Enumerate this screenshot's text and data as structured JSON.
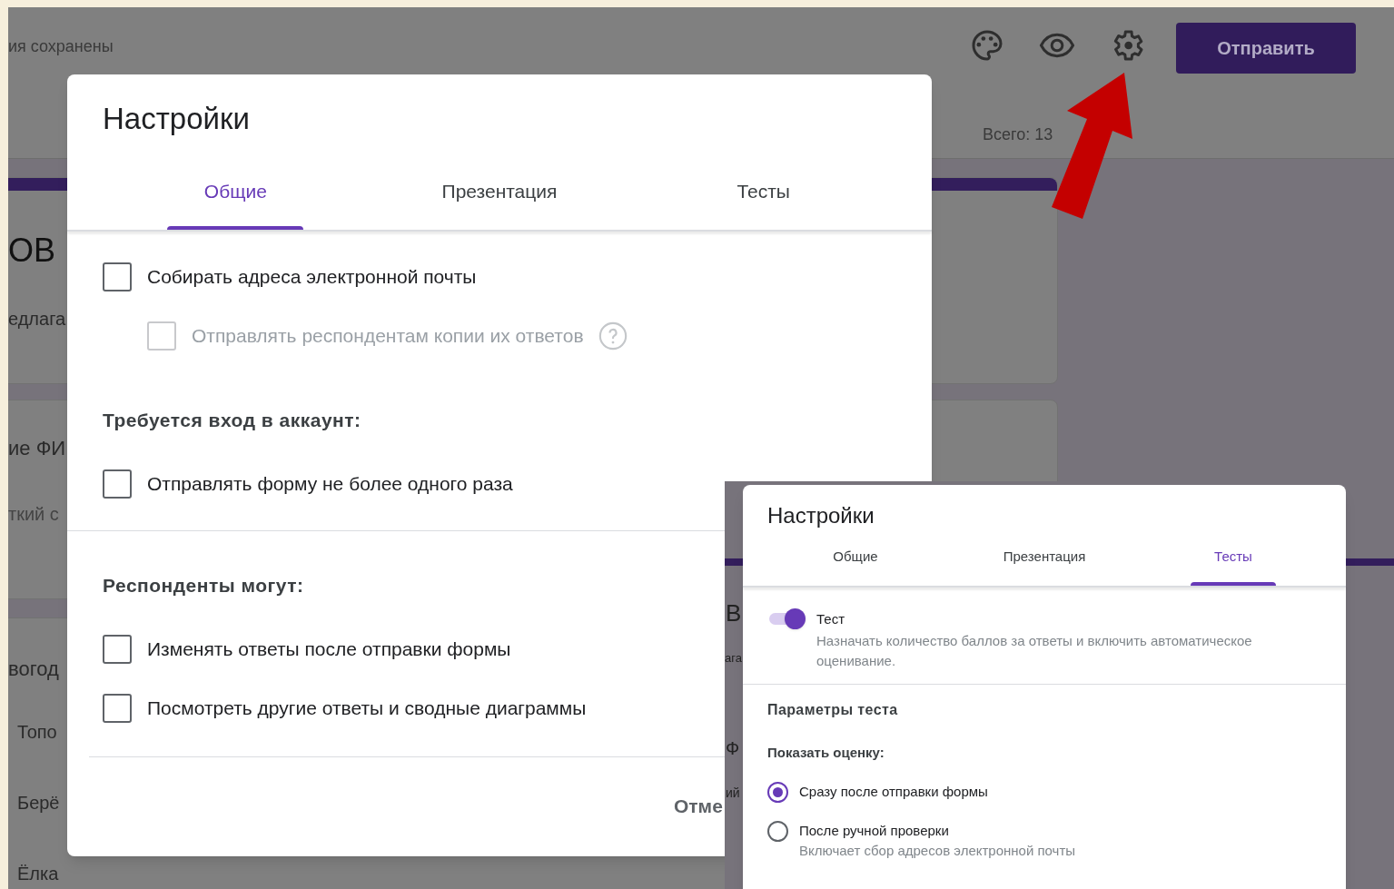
{
  "background": {
    "status": "ия сохранены",
    "send_button": "Отправить",
    "total": "Всего: 13",
    "fragments": [
      "ОВ",
      "едлага",
      "ие ФИ",
      "ткий с",
      "вогод",
      "Топо",
      "Берё",
      "Ёлка"
    ]
  },
  "dialog_general": {
    "title": "Настройки",
    "tabs": [
      {
        "label": "Общие",
        "selected": true
      },
      {
        "label": "Презентация",
        "selected": false
      },
      {
        "label": "Тесты",
        "selected": false
      }
    ],
    "groups": [
      [
        {
          "items": [
            {
              "label": "Собирать адреса электронной почты",
              "checked": false,
              "disabled": false,
              "help": false,
              "children": [
                {
                  "label": "Отправлять респондентам копии их ответов",
                  "checked": false,
                  "disabled": true,
                  "help": true
                }
              ]
            }
          ]
        },
        {
          "heading": "Требуется вход в аккаунт:",
          "items": [
            {
              "label": "Отправлять форму не более одного раза",
              "checked": false,
              "disabled": false,
              "help": false
            }
          ]
        }
      ],
      [
        {
          "heading": "Респонденты могут:",
          "items": [
            {
              "label": "Изменять ответы после отправки формы",
              "checked": false,
              "disabled": false,
              "help": false
            },
            {
              "label": "Посмотреть другие ответы и сводные диаграммы",
              "checked": false,
              "disabled": false,
              "help": false
            }
          ]
        }
      ]
    ],
    "cancel_button": "Отме"
  },
  "second_screenshot": {
    "fragments": [
      "В",
      "ага",
      "Ф",
      "ий"
    ],
    "dialog_tests": {
      "title": "Настройки",
      "tabs": [
        {
          "label": "Общие",
          "selected": false
        },
        {
          "label": "Презентация",
          "selected": false
        },
        {
          "label": "Тесты",
          "selected": true
        }
      ],
      "quiz_toggle": {
        "label": "Тест",
        "on": true,
        "description": "Назначать количество баллов за ответы и включить автоматическое оценивание."
      },
      "section_title": "Параметры теста",
      "subheading": "Показать оценку:",
      "radios": [
        {
          "label": "Сразу после отправки формы",
          "selected": true
        },
        {
          "label": "После ручной проверки",
          "selected": false,
          "note": "Включает сбор адресов электронной почты"
        }
      ]
    }
  }
}
